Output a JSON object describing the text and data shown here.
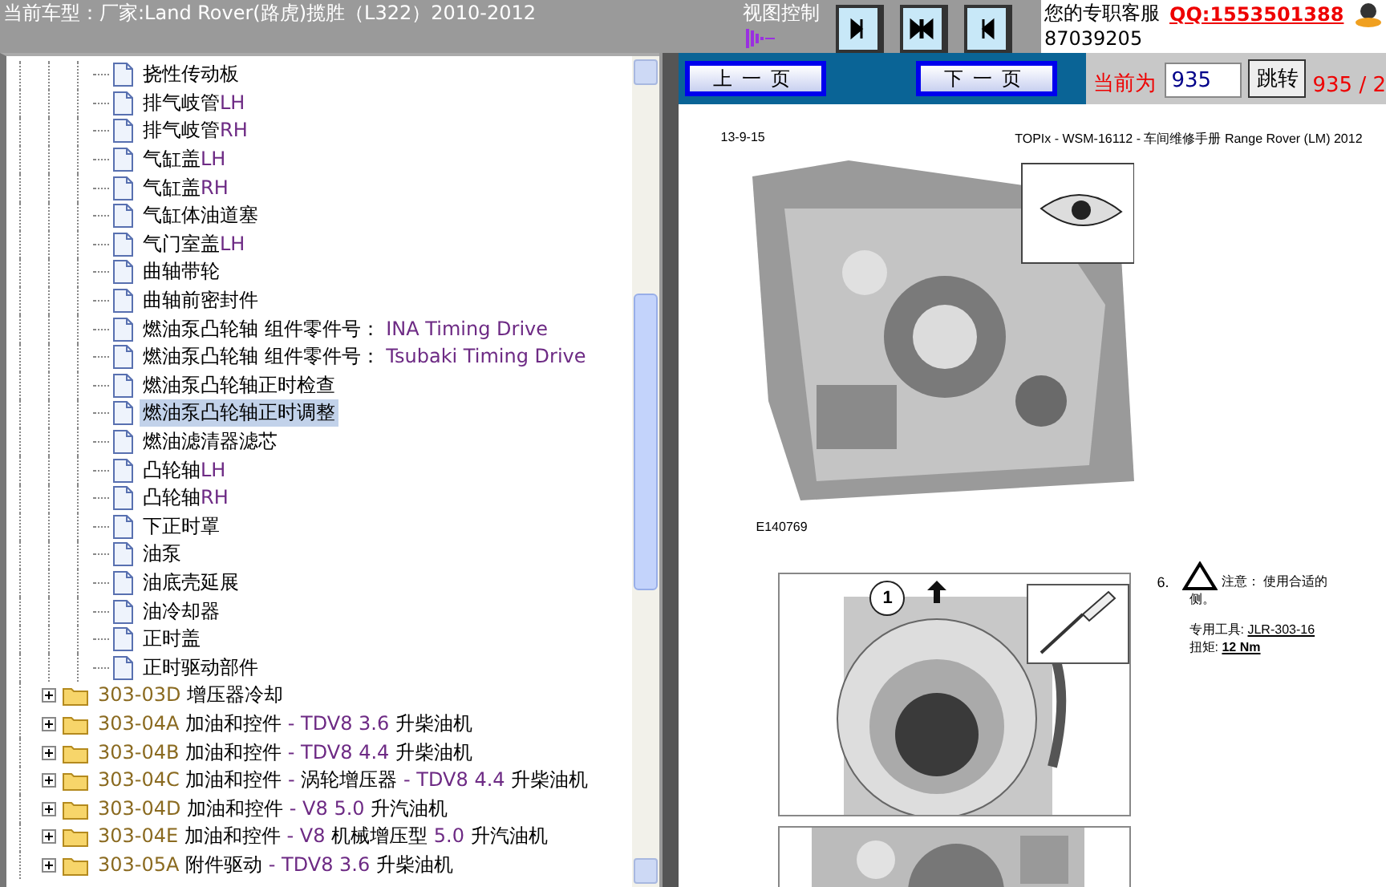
{
  "header": {
    "vehicle": "当前车型：厂家:Land Rover(路虎)揽胜（L322）2010-2012",
    "view_label": "视图控制",
    "view_buttons": [
      {
        "kind": "right"
      },
      {
        "kind": "both"
      },
      {
        "kind": "left"
      }
    ],
    "support_label": "您的专职客服",
    "qq": "QQ:1553501388",
    "phone": "87039205"
  },
  "tree": {
    "leaves": [
      {
        "label": "挠性传动板",
        "selected": false
      },
      {
        "label": "排气岐管LH",
        "selected": false
      },
      {
        "label": "排气岐管RH",
        "selected": false
      },
      {
        "label": "气缸盖LH",
        "selected": false
      },
      {
        "label": "气缸盖RH",
        "selected": false
      },
      {
        "label": "气缸体油道塞",
        "selected": false
      },
      {
        "label": "气门室盖LH",
        "selected": false
      },
      {
        "label": "曲轴带轮",
        "selected": false
      },
      {
        "label": "曲轴前密封件",
        "selected": false
      },
      {
        "label": "燃油泵凸轮轴 组件零件号： INA Timing Drive",
        "selected": false
      },
      {
        "label": "燃油泵凸轮轴 组件零件号： Tsubaki Timing Drive",
        "selected": false
      },
      {
        "label": "燃油泵凸轮轴正时检查",
        "selected": false
      },
      {
        "label": "燃油泵凸轮轴正时调整",
        "selected": true
      },
      {
        "label": "燃油滤清器滤芯",
        "selected": false
      },
      {
        "label": "凸轮轴LH",
        "selected": false
      },
      {
        "label": "凸轮轴RH",
        "selected": false
      },
      {
        "label": "下正时罩",
        "selected": false
      },
      {
        "label": "油泵",
        "selected": false
      },
      {
        "label": "油底壳延展",
        "selected": false
      },
      {
        "label": "油冷却器",
        "selected": false
      },
      {
        "label": "正时盖",
        "selected": false
      },
      {
        "label": "正时驱动部件",
        "selected": false
      }
    ],
    "folders": [
      {
        "code": "303-03D",
        "title": "增压器冷却",
        "expanded": false
      },
      {
        "code": "303-04A",
        "title": "加油和控件 - TDV8 3.6 升柴油机",
        "expanded": false
      },
      {
        "code": "303-04B",
        "title": "加油和控件 - TDV8 4.4 升柴油机",
        "expanded": false
      },
      {
        "code": "303-04C",
        "title": "加油和控件 - 涡轮增压器 - TDV8 4.4 升柴油机",
        "expanded": false
      },
      {
        "code": "303-04D",
        "title": "加油和控件 - V8 5.0 升汽油机",
        "expanded": false
      },
      {
        "code": "303-04E",
        "title": "加油和控件 - V8 机械增压型 5.0 升汽油机",
        "expanded": false
      },
      {
        "code": "303-05A",
        "title": "附件驱动 - TDV8 3.6 升柴油机",
        "expanded": false
      }
    ]
  },
  "pager": {
    "prev": "上一页",
    "next": "下一页",
    "current_label": "当前为",
    "page_value": "935",
    "go": "跳转",
    "page_count": "935 / 2"
  },
  "document": {
    "date": "13-9-15",
    "title": "TOPIx - WSM-16112 - 车间维修手册 Range Rover (LM) 2012",
    "figure_id": "E140769",
    "callout": "1",
    "step": {
      "number": "6.",
      "note": "注意： 使用合适的",
      "note_cont": "侧。",
      "tool_label": "专用工具:",
      "tool_value": "JLR-303-16",
      "torque_label": "扭矩:",
      "torque_value": "12 Nm"
    }
  }
}
